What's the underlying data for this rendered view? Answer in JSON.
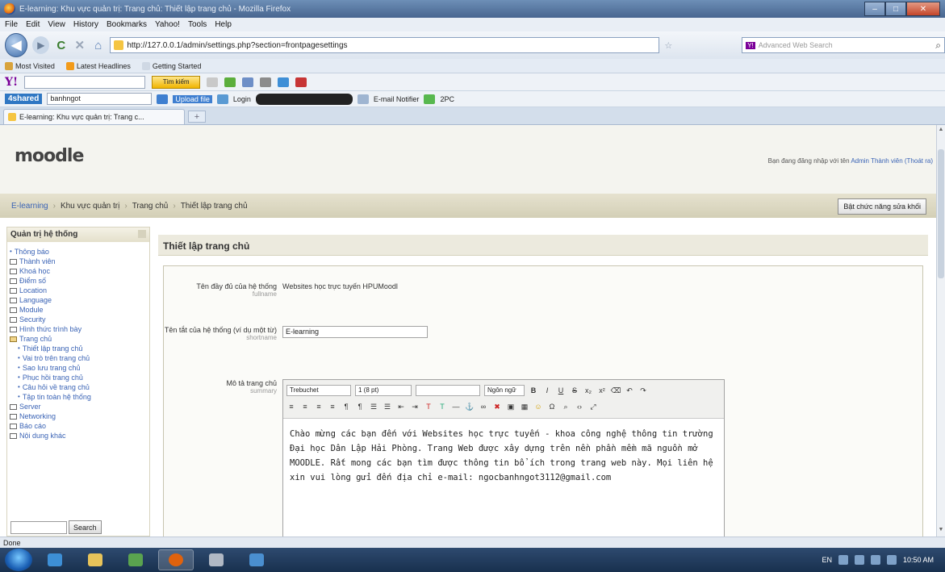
{
  "window": {
    "title": "E-learning: Khu vực quản trị: Trang chủ: Thiết lập trang chủ - Mozilla Firefox",
    "minimize": "–",
    "maximize": "□",
    "close": "✕"
  },
  "menu": [
    "File",
    "Edit",
    "View",
    "History",
    "Bookmarks",
    "Yahoo!",
    "Tools",
    "Help"
  ],
  "nav": {
    "url": "http://127.0.0.1/admin/settings.php?section=frontpagesettings",
    "search_placeholder": "Advanced Web Search"
  },
  "bookmarks": [
    "Most Visited",
    "Latest Headlines",
    "Getting Started"
  ],
  "yahoo": {
    "logo": "Y!",
    "button": "Tìm kiếm"
  },
  "shared": {
    "logo": "4shared",
    "input": "banhngot",
    "upload": "Upload file",
    "login": "Login",
    "email": "E-mail Notifier",
    "pc": "2PC"
  },
  "tab": {
    "title": "E-learning: Khu vực quản trị: Trang c..."
  },
  "page": {
    "logo_text": "moodle",
    "logged_in": "Bạn đang đăng nhập với tên",
    "logged_user": "Admin Thành viên (Thoát ra)",
    "breadcrumb": [
      "E-learning",
      "Khu vực quản trị",
      "Trang chủ",
      "Thiết lập trang chủ"
    ],
    "edit_button": "Bật chức năng sửa khối",
    "sidebar": {
      "title": "Quản trị hệ thống",
      "items": [
        {
          "label": "Thông báo",
          "kind": "dot"
        },
        {
          "label": "Thành viên",
          "kind": "folder"
        },
        {
          "label": "Khoá học",
          "kind": "folder"
        },
        {
          "label": "Điểm số",
          "kind": "folder"
        },
        {
          "label": "Location",
          "kind": "folder"
        },
        {
          "label": "Language",
          "kind": "folder"
        },
        {
          "label": "Module",
          "kind": "folder"
        },
        {
          "label": "Security",
          "kind": "folder"
        },
        {
          "label": "Hình thức trình bày",
          "kind": "folder"
        },
        {
          "label": "Trang chủ",
          "kind": "open"
        },
        {
          "label": "Thiết lập trang chủ",
          "kind": "sub"
        },
        {
          "label": "Vai trò trên trang chủ",
          "kind": "sub"
        },
        {
          "label": "Sao lưu trang chủ",
          "kind": "sub"
        },
        {
          "label": "Phục hồi trang chủ",
          "kind": "sub"
        },
        {
          "label": "Câu hỏi về trang chủ",
          "kind": "sub"
        },
        {
          "label": "Tập tin toàn hệ thống",
          "kind": "sub"
        },
        {
          "label": "Server",
          "kind": "folder"
        },
        {
          "label": "Networking",
          "kind": "folder"
        },
        {
          "label": "Báo cáo",
          "kind": "folder"
        },
        {
          "label": "Nội dung khác",
          "kind": "folder"
        }
      ],
      "search_button": "Search"
    },
    "main_title": "Thiết lập trang chủ",
    "fullname_label": "Tên đầy đủ của hệ thống",
    "fullname_key": "fullname",
    "fullname_value": "Websites học trực tuyến HPUMoodl",
    "shortname_label": "Tên tắt của hệ thống (ví dụ một từ)",
    "shortname_key": "shortname",
    "shortname_value": "E-learning",
    "summary_label": "Mô tả trang chủ",
    "summary_key": "summary",
    "editor": {
      "font": "Trebuchet",
      "size": "1 (8 pt)",
      "lang": "Ngôn ngữ",
      "text": "Chào mừng các bạn đến với Websites học trực tuyến - khoa công nghệ thông tin trường Đại học Dân Lập Hải Phòng. Trang Web được xây dựng trên nền phần mềm mã nguồn mở MOODLE. Rất mong các bạn tìm được thông tin bổ ích trong trang web này. Mọi liên hệ xin vui lòng gửi đến địa chỉ e-mail: ngocbanhngot3112@gmail.com"
    }
  },
  "status": "Done",
  "tray": {
    "lang": "EN",
    "time": "10:50 AM"
  }
}
